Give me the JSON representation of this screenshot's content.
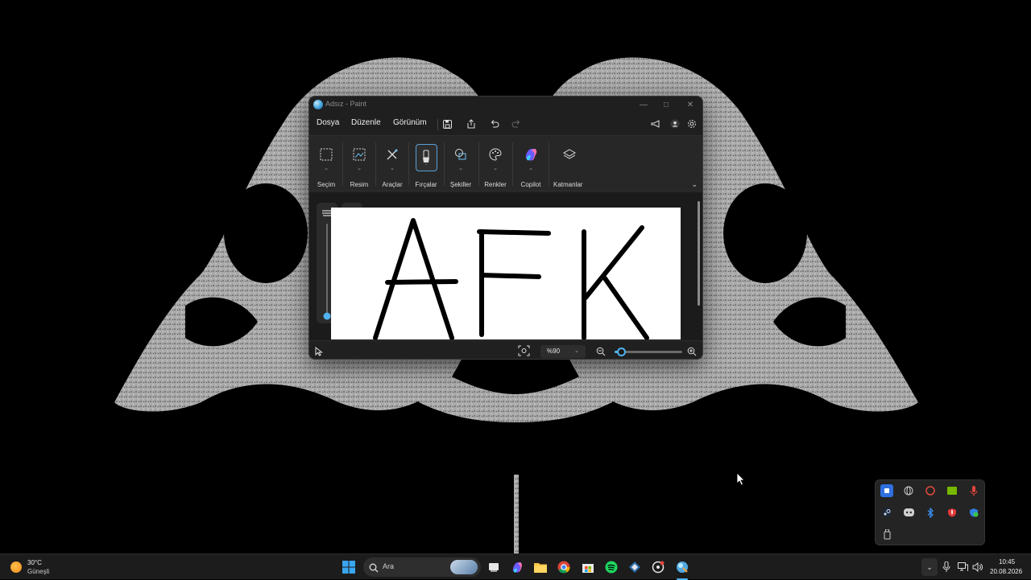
{
  "window": {
    "title": "Adsız - Paint",
    "menu": [
      "Dosya",
      "Düzenle",
      "Görünüm"
    ]
  },
  "ribbon": {
    "tools": [
      "Seçim",
      "Resim",
      "Araçlar",
      "Fırçalar",
      "Şekiller",
      "Renkler",
      "Copilot",
      "Katmanlar"
    ],
    "active_tool": "Fırçalar"
  },
  "canvas": {
    "drawn_text": "AFK"
  },
  "sliders": {
    "size_level": 0.0,
    "opacity_level": 1.0
  },
  "status": {
    "zoom": "%90",
    "zoom_slider_level": 0.1
  },
  "taskbar": {
    "weather_temp": "30°C",
    "weather_desc": "Güneşli",
    "search_placeholder": "Ara",
    "time": "10:45",
    "date": "20.08.2026"
  },
  "colors": {
    "accent": "#4fb3ef",
    "window_bg": "#1f1f1f",
    "ribbon_bg": "#272727",
    "taskbar_bg": "#1c1c1c"
  }
}
